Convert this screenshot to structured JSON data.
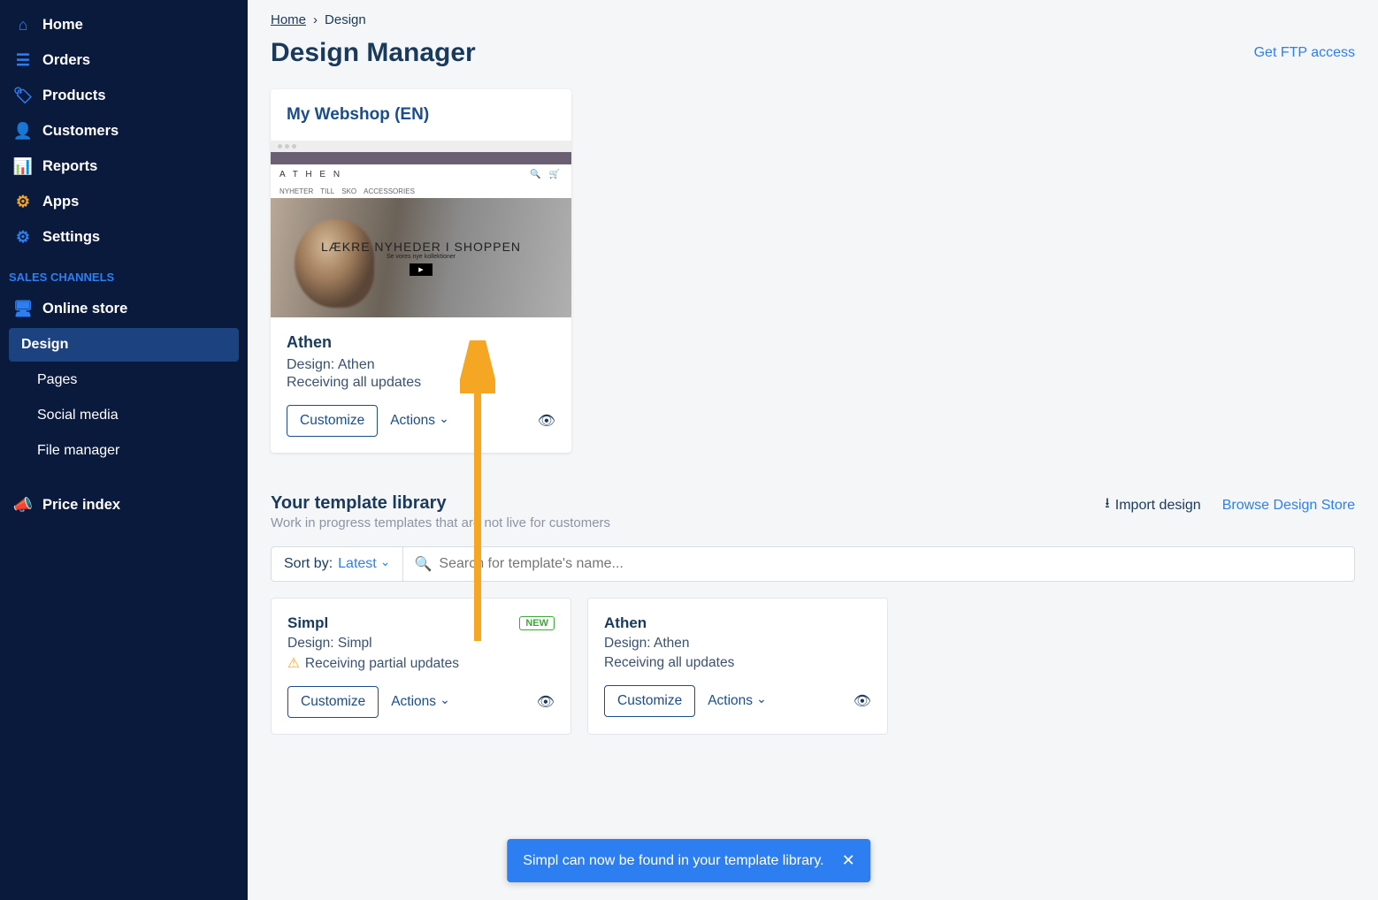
{
  "sidebar": {
    "items": [
      {
        "label": "Home"
      },
      {
        "label": "Orders"
      },
      {
        "label": "Products"
      },
      {
        "label": "Customers"
      },
      {
        "label": "Reports"
      },
      {
        "label": "Apps"
      },
      {
        "label": "Settings"
      }
    ],
    "section_label": "SALES CHANNELS",
    "online_store": "Online store",
    "subs": [
      {
        "label": "Design"
      },
      {
        "label": "Pages"
      },
      {
        "label": "Social media"
      },
      {
        "label": "File manager"
      }
    ],
    "price_index": "Price index"
  },
  "breadcrumb": {
    "home": "Home",
    "sep": "›",
    "current": "Design"
  },
  "page": {
    "title": "Design Manager",
    "ftp": "Get FTP access"
  },
  "shop_card": {
    "title": "My Webshop (EN)",
    "preview": {
      "logo": "A T H E N",
      "hero": "LÆKRE NYHEDER I SHOPPEN",
      "sub": "Se vores nye kollektioner",
      "nav": [
        "NYHETER",
        "TILL",
        "SKO",
        "ACCESSORIES"
      ]
    },
    "name": "Athen",
    "design": "Design: Athen",
    "updates": "Receiving all updates",
    "customize": "Customize",
    "actions": "Actions"
  },
  "library": {
    "title": "Your template library",
    "sub": "Work in progress templates that are not live for customers",
    "import": "Import design",
    "browse": "Browse Design Store",
    "sortby": "Sort by:",
    "sortval": "Latest",
    "search_ph": "Search for template's name..."
  },
  "templates": [
    {
      "name": "Simpl",
      "design": "Design: Simpl",
      "updates": "Receiving partial updates",
      "warn": true,
      "badge": "NEW",
      "customize": "Customize",
      "actions": "Actions"
    },
    {
      "name": "Athen",
      "design": "Design: Athen",
      "updates": "Receiving all updates",
      "warn": false,
      "customize": "Customize",
      "actions": "Actions"
    }
  ],
  "toast": "Simpl can now be found in your template library."
}
